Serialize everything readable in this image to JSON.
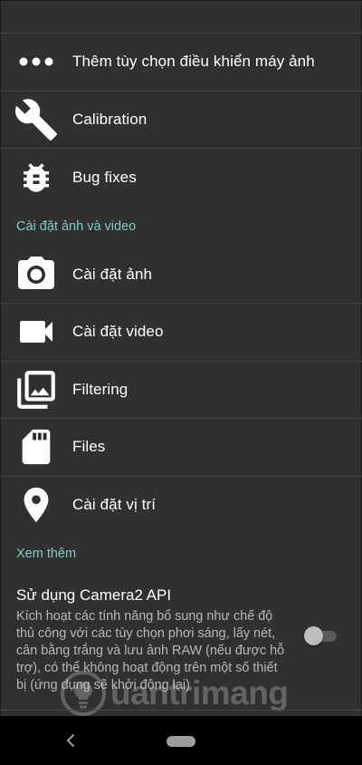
{
  "menu_items_top": [
    {
      "label": "Thêm tùy chọn điều khiển máy ảnh",
      "icon": "more-horizontal-icon"
    },
    {
      "label": "Calibration",
      "icon": "wrench-icon"
    },
    {
      "label": "Bug fixes",
      "icon": "bug-icon"
    }
  ],
  "section_photo_video": "Cài đặt ảnh và video",
  "menu_items_photo": [
    {
      "label": "Cài đặt ảnh",
      "icon": "camera-icon"
    },
    {
      "label": "Cài đặt video",
      "icon": "videocam-icon"
    },
    {
      "label": "Filtering",
      "icon": "photo-library-icon"
    },
    {
      "label": "Files",
      "icon": "sd-card-icon"
    },
    {
      "label": "Cài đặt vị trí",
      "icon": "location-pin-icon"
    }
  ],
  "section_more": "Xem thêm",
  "camera2": {
    "title": "Sử dụng Camera2 API",
    "summary": "Kích hoạt các tính năng bổ sung như chế độ thủ công với các tùy chọn phơi sáng, lấy nét, cân bằng trắng và lưu ảnh RAW (nếu được hỗ trợ), có thể không hoạt động trên một số thiết bị (ứng dụng sẽ khởi động lại)",
    "enabled": false
  },
  "watermark": "uantrimang",
  "colors": {
    "background": "#303030",
    "accent_section": "#80cbc4",
    "navbar": "#000000"
  }
}
